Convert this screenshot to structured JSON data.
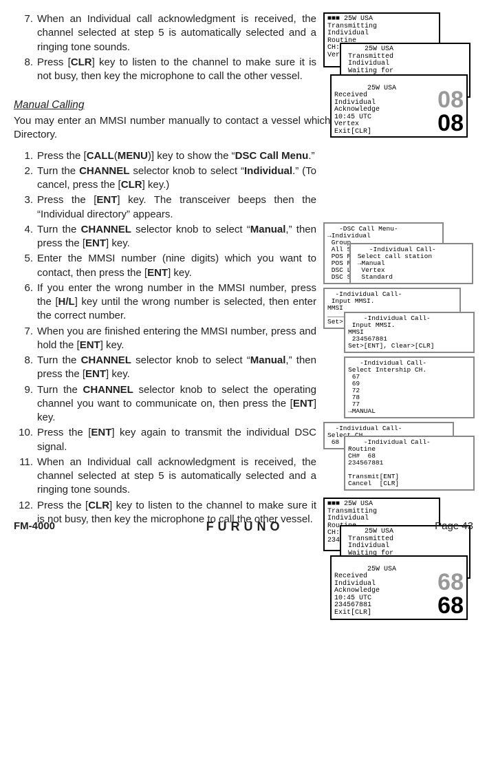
{
  "steps_top": [
    {
      "n": "7.",
      "t": "When an Individual call acknowledgment is received, the channel selected at step 5 is automatically selected and a ringing tone sounds."
    },
    {
      "n": "8.",
      "t": "Press [<b>CLR</b>] key to listen to the channel to make sure it is not busy, then key the microphone to call the other vessel."
    }
  ],
  "section_title": "Manual Calling",
  "intro": "You may enter an MMSI number manually to contact a vessel which is not stored in the Individual Directory.",
  "steps_bottom": [
    {
      "n": "1.",
      "t": "Press the [<b>CALL</b>(<b>MENU</b>)] key to show the “<b>DSC Call Menu</b>.”"
    },
    {
      "n": "2.",
      "t": "Turn the <b>CHANNEL</b> selector knob to select “<b>Individual</b>.” (To cancel, press the [<b>CLR</b>] key.)"
    },
    {
      "n": "3.",
      "t": "Press the [<b>ENT</b>] key. The transceiver beeps then the “Individual directory” appears."
    },
    {
      "n": "4.",
      "t": "Turn the <b>CHANNEL</b> selector knob to select “<b>Manual</b>,” then press the [<b>ENT</b>] key."
    },
    {
      "n": "5.",
      "t": "Enter the MMSI number (nine digits) which you want to contact, then press the [<b>ENT</b>] key."
    },
    {
      "n": "6.",
      "t": "If you enter the wrong number in the MMSI number, press the [<b>H/L</b>] key until the wrong number is selected, then enter the correct number."
    },
    {
      "n": "7.",
      "t": "When you are finished entering the MMSI number, press and hold the [<b>ENT</b>] key."
    },
    {
      "n": "8.",
      "t": "Turn the <b>CHANNEL</b> selector knob to select “<b>Manual</b>,” then press the [<b>ENT</b>] key."
    },
    {
      "n": "9.",
      "t": "Turn the <b>CHANNEL</b> selector knob to select the operating channel you want to communicate on, then press the [<b>ENT</b>] key."
    },
    {
      "n": "10.",
      "t": "Press the [<b>ENT</b>] key again to transmit the individual DSC signal."
    },
    {
      "n": "11.",
      "t": "When an Individual call acknowledgment is received, the channel selected at step 5 is automatically selected and a ringing tone sounds."
    },
    {
      "n": "12.",
      "t": "Press the [<b>CLR</b>] key to listen to the channel to make sure it is not busy, then key the microphone to call the other vessel."
    }
  ],
  "lcd_top": [
    "■■■ 25W USA\nTransmitting\nIndividual\nRoutine\nCH: 08\nVertex",
    "     25W USA\n Transmitted\n Individual\n Waiting for\n Acknowledge",
    "  25W USA\nReceived\nIndividual\nAcknowledge\n10:45 UTC\nVertex\nExit[CLR]"
  ],
  "big_top": "08",
  "lcd_mid": [
    "   -DSC Call Menu-\n→Individual\n Group\n All Ships\n POS Request\n POS Report\n DSC Log\n DSC Setup",
    "    -Individual Call-\n Select call station\n →Manual\n  Vertex\n  Standard",
    "  -Individual Call-\n Input MMSI.\nMMSI\n_________\nSet>[ENT]",
    "    -Individual Call-\n Input MMSI.\nMMSI\n 234567881\nSet>[ENT], Clear>[CLR]",
    "   -Individual Call-\nSelect Intership CH.\n 67\n 69\n 72\n 78\n 77\n→MANUAL",
    "  -Individual Call-\nSelect CH.\n 68",
    "    -Individual Call-\nRoutine\nCH#  68\n234567881\n\nTransmit[ENT]\nCancel  [CLR]"
  ],
  "lcd_bot": [
    "■■■ 25W USA\nTransmitting\nIndividual\nRoutine\nCH: 68\n234567881",
    "     25W USA\n Transmitted\n Individual\n Waiting for\n Acknowledge",
    "  25W USA\nReceived\nIndividual\nAcknowledge\n10:45 UTC\n234567881\nExit[CLR]"
  ],
  "big_bot": "68",
  "footer": {
    "model": "FM-4000",
    "brand": "FURUNO",
    "page": "Page 43"
  }
}
